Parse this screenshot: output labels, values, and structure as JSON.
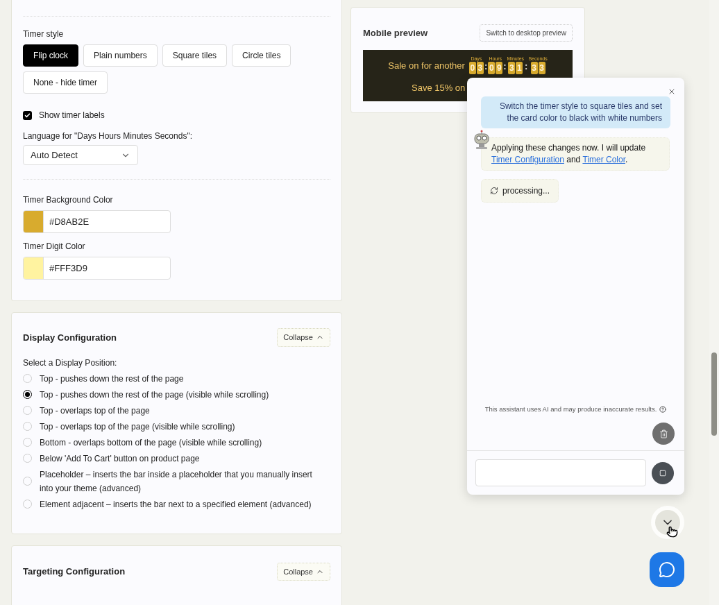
{
  "timer_settings": {
    "style_label": "Timer style",
    "styles": [
      {
        "label": "Flip clock",
        "selected": true
      },
      {
        "label": "Plain numbers",
        "selected": false
      },
      {
        "label": "Square tiles",
        "selected": false
      },
      {
        "label": "Circle tiles",
        "selected": false
      },
      {
        "label": "None - hide timer",
        "selected": false
      }
    ],
    "show_labels": {
      "label": "Show timer labels",
      "checked": true
    },
    "language": {
      "label": "Language for \"Days Hours Minutes Seconds\":",
      "value": "Auto Detect"
    },
    "colors": [
      {
        "label": "Timer Background Color",
        "value": "#D8AB2E",
        "color": "#d8ab2e"
      },
      {
        "label": "Timer Digit Color",
        "value": "#FFF3D9",
        "color": "#fff3a0"
      }
    ]
  },
  "display": {
    "title": "Display Configuration",
    "collapse": "Collapse",
    "prompt": "Select a Display Position:",
    "positions": [
      {
        "label": "Top - pushes down the rest of the page",
        "selected": false
      },
      {
        "label": "Top - pushes down the rest of the page (visible while scrolling)",
        "selected": true
      },
      {
        "label": "Top - overlaps top of the page",
        "selected": false
      },
      {
        "label": "Top - overlaps top of the page (visible while scrolling)",
        "selected": false
      },
      {
        "label": "Bottom - overlaps bottom of the page (visible while scrolling)",
        "selected": false
      },
      {
        "label": "Below 'Add To Cart' button on product page",
        "selected": false
      },
      {
        "label": "Placeholder – inserts the bar inside a placeholder that you manually insert into your theme (advanced)",
        "selected": false
      },
      {
        "label": "Element adjacent – inserts the bar next to a specified element (advanced)",
        "selected": false
      }
    ]
  },
  "targeting": {
    "title": "Targeting Configuration",
    "collapse": "Collapse"
  },
  "preview": {
    "title": "Mobile preview",
    "switch_button": "Switch to desktop preview",
    "headline": "Sale on for another",
    "separator": ":",
    "units": [
      {
        "label": "Days",
        "digits": [
          "0",
          "3"
        ]
      },
      {
        "label": "Hours",
        "digits": [
          "0",
          "9"
        ]
      },
      {
        "label": "Minutes",
        "digits": [
          "3",
          "1"
        ]
      },
      {
        "label": "Seconds",
        "digits": [
          "3",
          "3"
        ]
      }
    ],
    "line2": "Save 15% on"
  },
  "chat": {
    "user_message": "Switch the timer style to square tiles and set the card color to black with white numbers",
    "bot_message": [
      {
        "kind": "text",
        "text": "Applying these changes now. I will update "
      },
      {
        "kind": "link",
        "text": "Timer Configuration"
      },
      {
        "kind": "text",
        "text": " and "
      },
      {
        "kind": "link",
        "text": "Timer Color"
      },
      {
        "kind": "text",
        "text": "."
      }
    ],
    "status": "processing...",
    "disclaimer": "This assistant uses AI and may produce inaccurate results."
  }
}
